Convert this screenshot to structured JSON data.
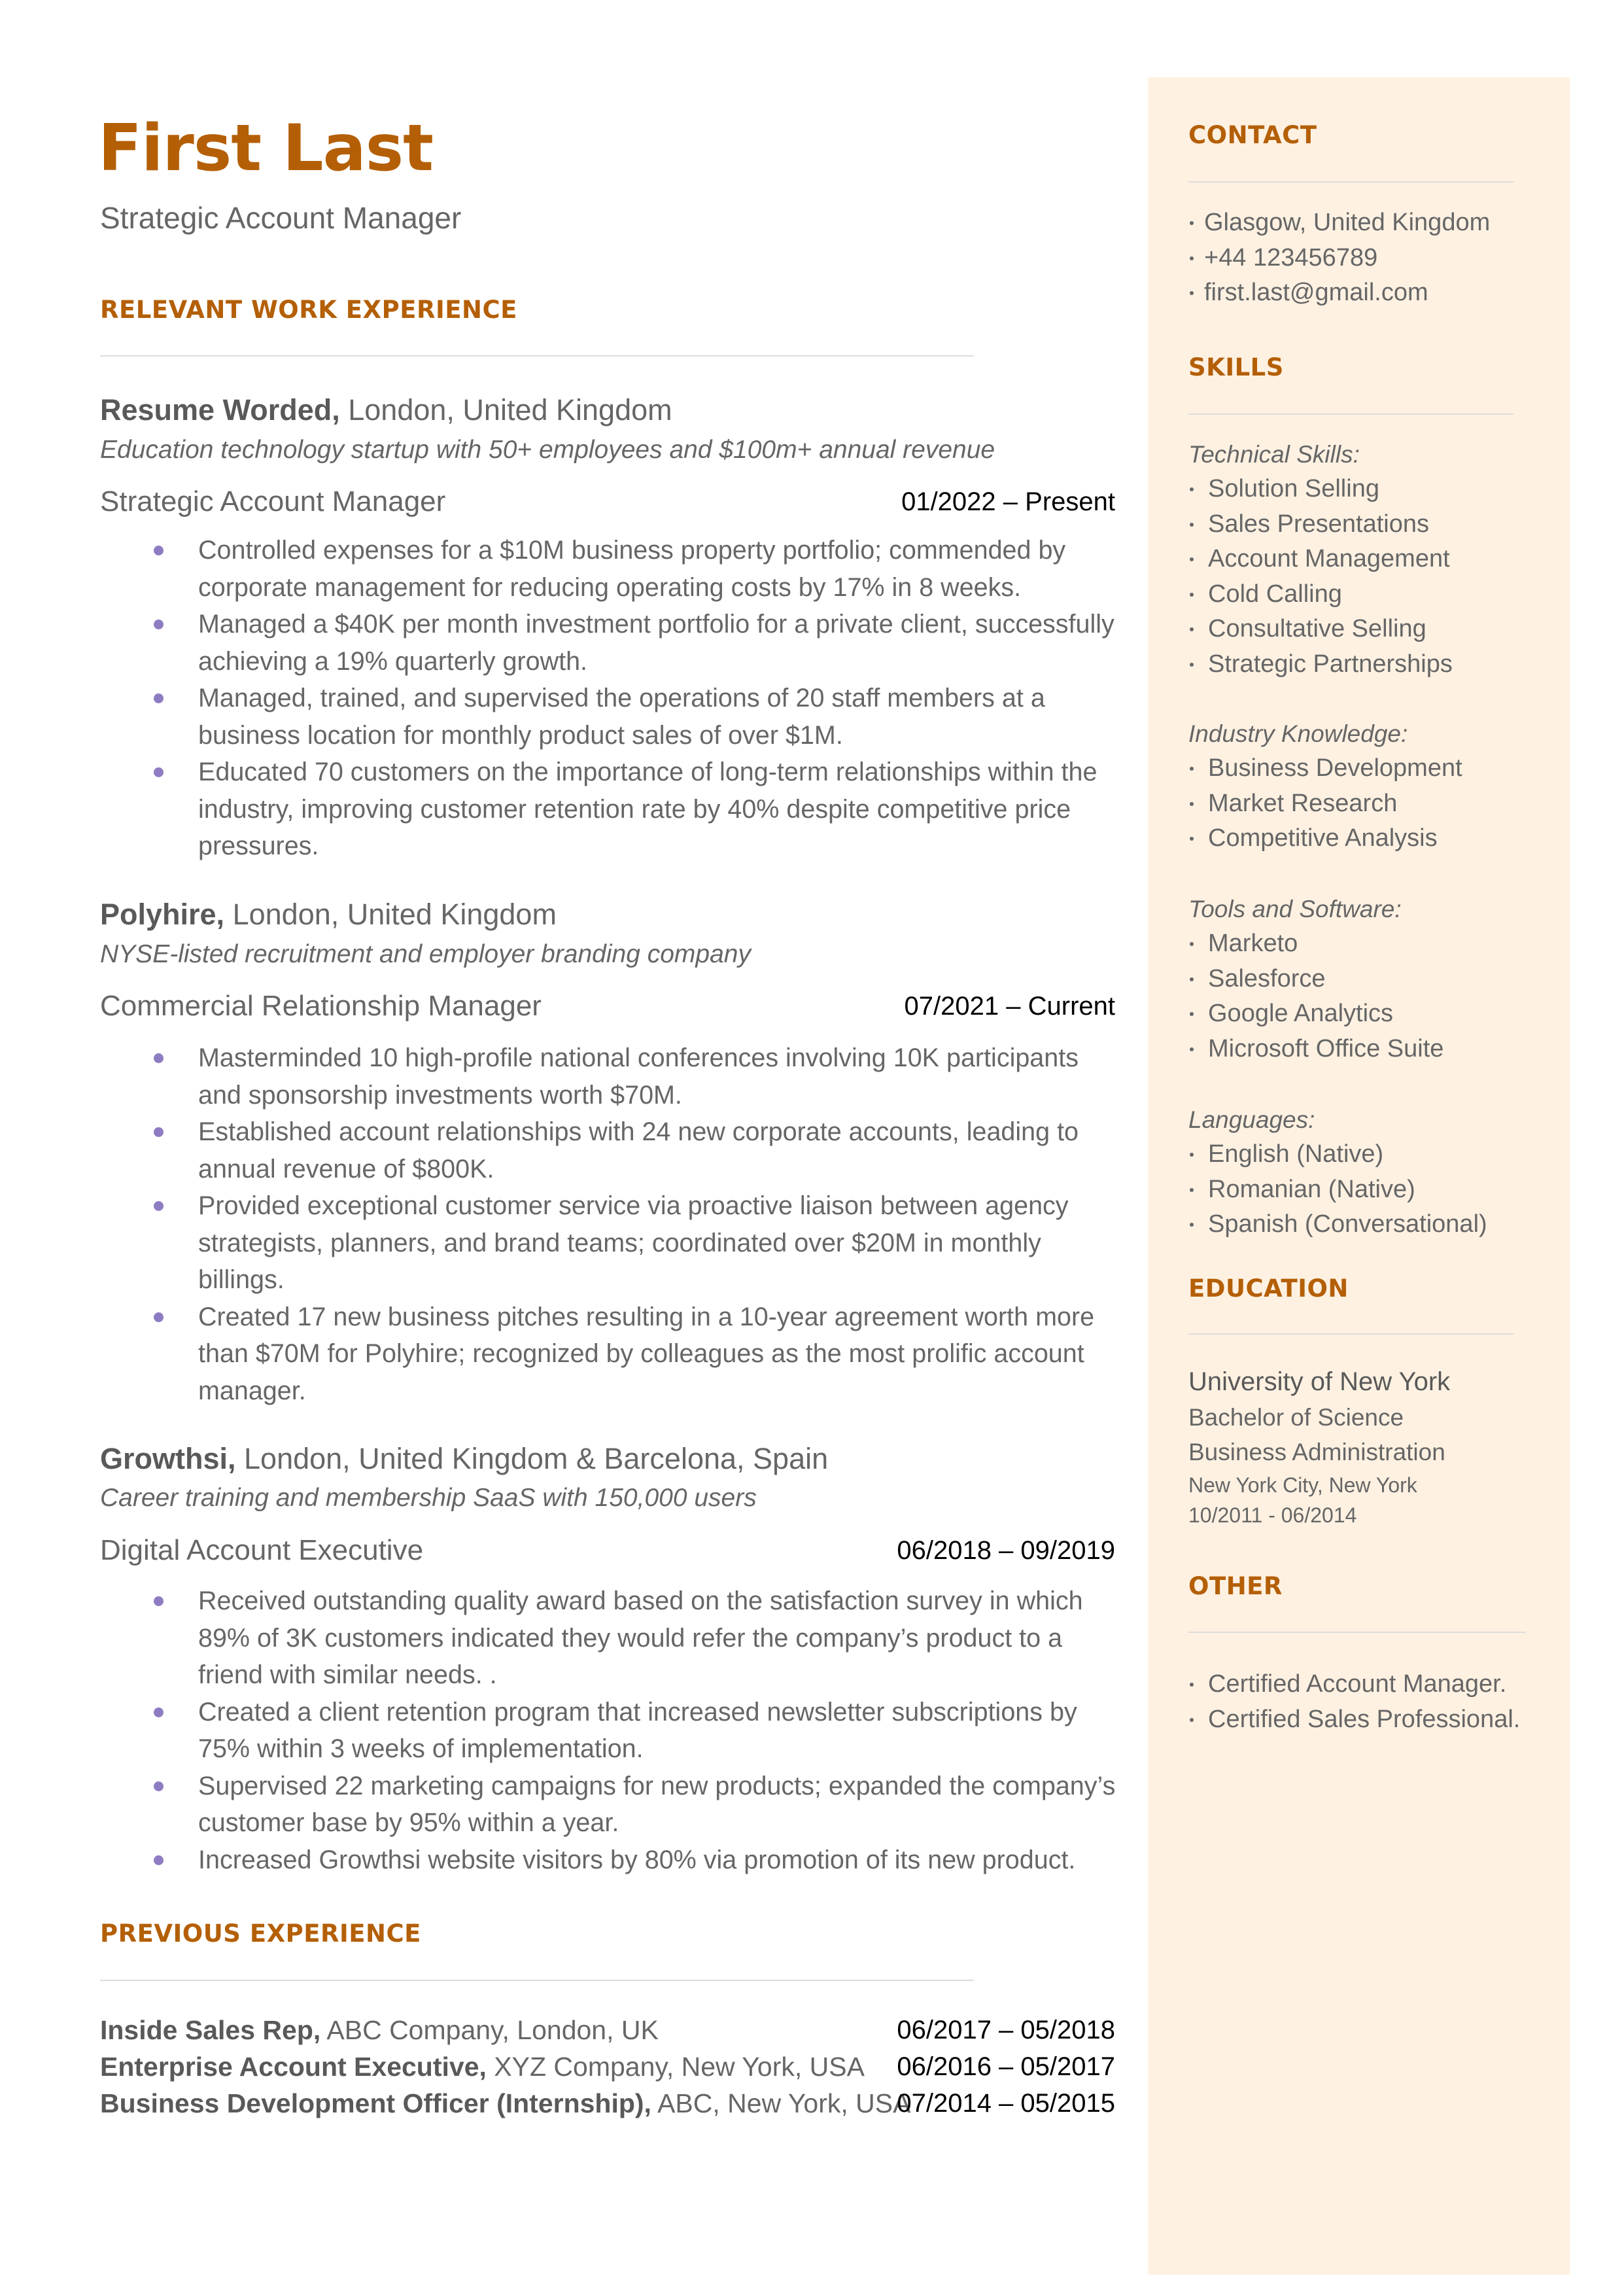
{
  "header": {
    "name": "First Last",
    "title": "Strategic Account Manager"
  },
  "colors": {
    "accent": "#B45F06",
    "bullet": "#8E7CC3",
    "sidebar_bg": "#FEF1E2",
    "text": "#666666"
  },
  "relevant_experience": {
    "heading": "RELEVANT WORK EXPERIENCE",
    "jobs": [
      {
        "company": "Resume Worded,",
        "location": " London, United Kingdom",
        "description": "Education technology startup with 50+ employees and $100m+ annual revenue",
        "role": "Strategic Account Manager",
        "dates": "01/2022 – Present",
        "bullets": [
          "Controlled expenses for a $10M business property portfolio; commended by corporate management for reducing operating costs by 17% in 8 weeks.",
          "Managed a $40K per month investment portfolio for a private client, successfully achieving a 19% quarterly growth.",
          "Managed, trained, and supervised the operations of 20 staff members at a business location for monthly product sales of over $1M.",
          "Educated 70 customers on the importance of long-term relationships within the industry, improving customer retention rate by 40% despite competitive price pressures."
        ]
      },
      {
        "company": "Polyhire,",
        "location": " London, United Kingdom",
        "description": "NYSE-listed recruitment and employer branding company",
        "role": "Commercial Relationship Manager",
        "dates": "07/2021 – Current",
        "bullets": [
          "Masterminded 10 high-profile national conferences involving 10K participants and sponsorship investments worth $70M.",
          "Established account relationships with 24 new corporate accounts, leading to annual revenue of $800K.",
          "Provided exceptional customer service via proactive liaison between agency strategists, planners, and brand teams; coordinated over $20M in monthly billings.",
          "Created 17 new business pitches resulting in a 10-year agreement worth more than $70M for Polyhire; recognized by colleagues as the most prolific account manager."
        ]
      },
      {
        "company": "Growthsi,",
        "location": " London, United Kingdom & Barcelona, Spain",
        "description": "Career training and membership SaaS with 150,000 users",
        "role": "Digital Account Executive",
        "dates": "06/2018 – 09/2019",
        "bullets": [
          "Received outstanding quality award based on the satisfaction survey in which 89% of 3K customers indicated they would refer the company’s product to a friend with similar needs. .",
          "Created a client retention program that increased newsletter subscriptions by 75% within 3 weeks of implementation.",
          "Supervised 22 marketing campaigns for new products; expanded the company’s customer base by 95%  within a year.",
          "Increased Growthsi website visitors by 80% via promotion of its new product."
        ]
      }
    ]
  },
  "previous_experience": {
    "heading": "PREVIOUS EXPERIENCE",
    "rows": [
      {
        "title": "Inside Sales Rep,",
        "details": " ABC Company, London, UK",
        "dates": "06/2017 – 05/2018"
      },
      {
        "title": "Enterprise Account Executive,",
        "details": " XYZ Company, New York, USA",
        "dates": "06/2016 – 05/2017"
      },
      {
        "title": "Business Development Officer (Internship),",
        "details": " ABC, New York, USA",
        "dates": "07/2014 – 05/2015"
      }
    ]
  },
  "sidebar": {
    "contact": {
      "heading": "CONTACT",
      "items": [
        "Glasgow, United Kingdom",
        "+44 123456789",
        "first.last@gmail.com"
      ]
    },
    "skills": {
      "heading": "SKILLS",
      "groups": [
        {
          "label": "Technical Skills:",
          "items": [
            "Solution Selling",
            "Sales Presentations",
            "Account Management",
            "Cold Calling",
            "Consultative Selling",
            "Strategic Partnerships"
          ]
        },
        {
          "label": "Industry Knowledge:",
          "items": [
            "Business Development",
            "Market Research",
            "Competitive Analysis"
          ]
        },
        {
          "label": "Tools and Software:",
          "items": [
            "Marketo",
            "Salesforce",
            "Google Analytics",
            "Microsoft Office Suite"
          ]
        },
        {
          "label": "Languages:",
          "items": [
            "English (Native)",
            "Romanian (Native)",
            "Spanish (Conversational)"
          ]
        }
      ]
    },
    "education": {
      "heading": "EDUCATION",
      "school": "University of New York",
      "degree": "Bachelor of Science",
      "field": "Business Administration",
      "location": "New York City, New York",
      "dates": "10/2011 - 06/2014"
    },
    "other": {
      "heading": "OTHER",
      "items": [
        "Certified Account Manager.",
        "Certified Sales Professional."
      ]
    }
  }
}
